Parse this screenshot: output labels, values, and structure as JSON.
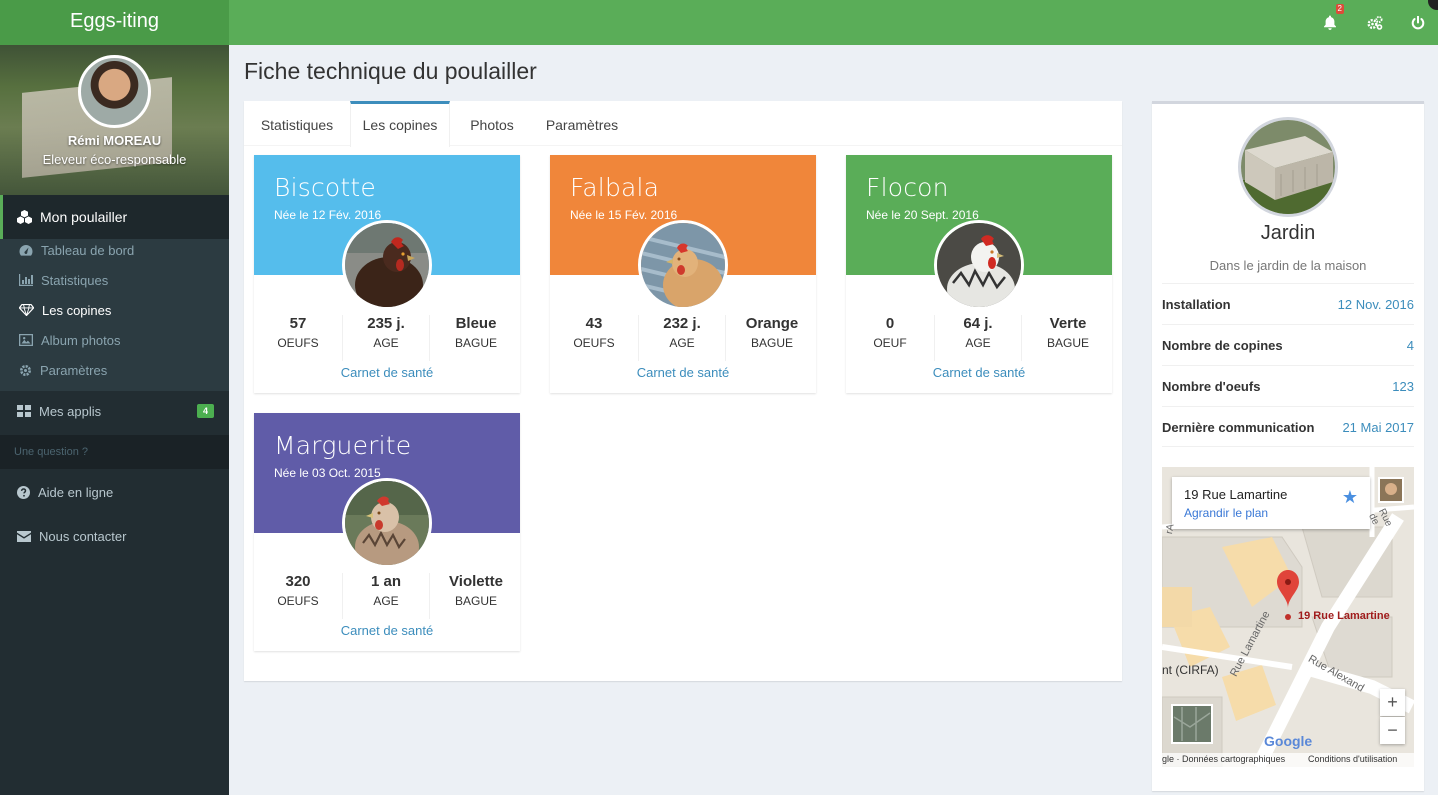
{
  "app": {
    "title": "Eggs-iting"
  },
  "topbar": {
    "notifications": "2"
  },
  "user": {
    "name": "Rémi MOREAU",
    "role": "Eleveur éco-responsable"
  },
  "sidebar": {
    "main": "Mon poulailler",
    "items": [
      {
        "label": "Tableau de bord",
        "icon": "dashboard-icon"
      },
      {
        "label": "Statistiques",
        "icon": "bar-chart-icon"
      },
      {
        "label": "Les copines",
        "icon": "diamond-icon"
      },
      {
        "label": "Album photos",
        "icon": "image-icon"
      },
      {
        "label": "Paramètres",
        "icon": "gear-icon"
      }
    ],
    "apps": {
      "label": "Mes applis",
      "badge": "4"
    },
    "header": "Une question ?",
    "help": "Aide en ligne",
    "contact": "Nous contacter"
  },
  "page": {
    "title": "Fiche technique du poulailler"
  },
  "tabs": [
    "Statistiques",
    "Les copines",
    "Photos",
    "Paramètres"
  ],
  "hens": [
    {
      "name": "Biscotte",
      "born": "Née le 12 Fév. 2016",
      "color": "#55bdec",
      "eggs": "57",
      "eggs_label": "OEUFS",
      "age": "235 j.",
      "age_label": "AGE",
      "ring": "Bleue",
      "ring_label": "BAGUE",
      "link": "Carnet de santé"
    },
    {
      "name": "Falbala",
      "born": "Née le 15 Fév. 2016",
      "color": "#f0863a",
      "eggs": "43",
      "eggs_label": "OEUFS",
      "age": "232 j.",
      "age_label": "AGE",
      "ring": "Orange",
      "ring_label": "BAGUE",
      "link": "Carnet de santé"
    },
    {
      "name": "Flocon",
      "born": "Née le 20 Sept. 2016",
      "color": "#5aad58",
      "eggs": "0",
      "eggs_label": "OEUF",
      "age": "64 j.",
      "age_label": "AGE",
      "ring": "Verte",
      "ring_label": "BAGUE",
      "link": "Carnet de santé"
    },
    {
      "name": "Marguerite",
      "born": "Née le 03 Oct. 2015",
      "color": "#605ca8",
      "eggs": "320",
      "eggs_label": "OEUFS",
      "age": "1 an",
      "age_label": "AGE",
      "ring": "Violette",
      "ring_label": "BAGUE",
      "link": "Carnet de santé"
    }
  ],
  "coop": {
    "name": "Jardin",
    "description": "Dans le jardin de la maison",
    "info": [
      {
        "key": "Installation",
        "value": "12 Nov. 2016"
      },
      {
        "key": "Nombre de copines",
        "value": "4"
      },
      {
        "key": "Nombre d'oeufs",
        "value": "123"
      },
      {
        "key": "Dernière communication",
        "value": "21 Mai 2017"
      }
    ]
  },
  "map": {
    "address": "19 Rue Lamartine",
    "enlarge": "Agrandir le plan",
    "pin_label": "19 Rue Lamartine",
    "place": "nt (CIRFA)",
    "street1": "Rue Lamartine",
    "street2": "Rue Alexand",
    "street3": "Rue de",
    "street4": "rA",
    "google": "Google",
    "footer_data": "gle · Données cartographiques",
    "footer_terms": "Conditions d'utilisation",
    "zoom_in": "+",
    "zoom_out": "−"
  }
}
